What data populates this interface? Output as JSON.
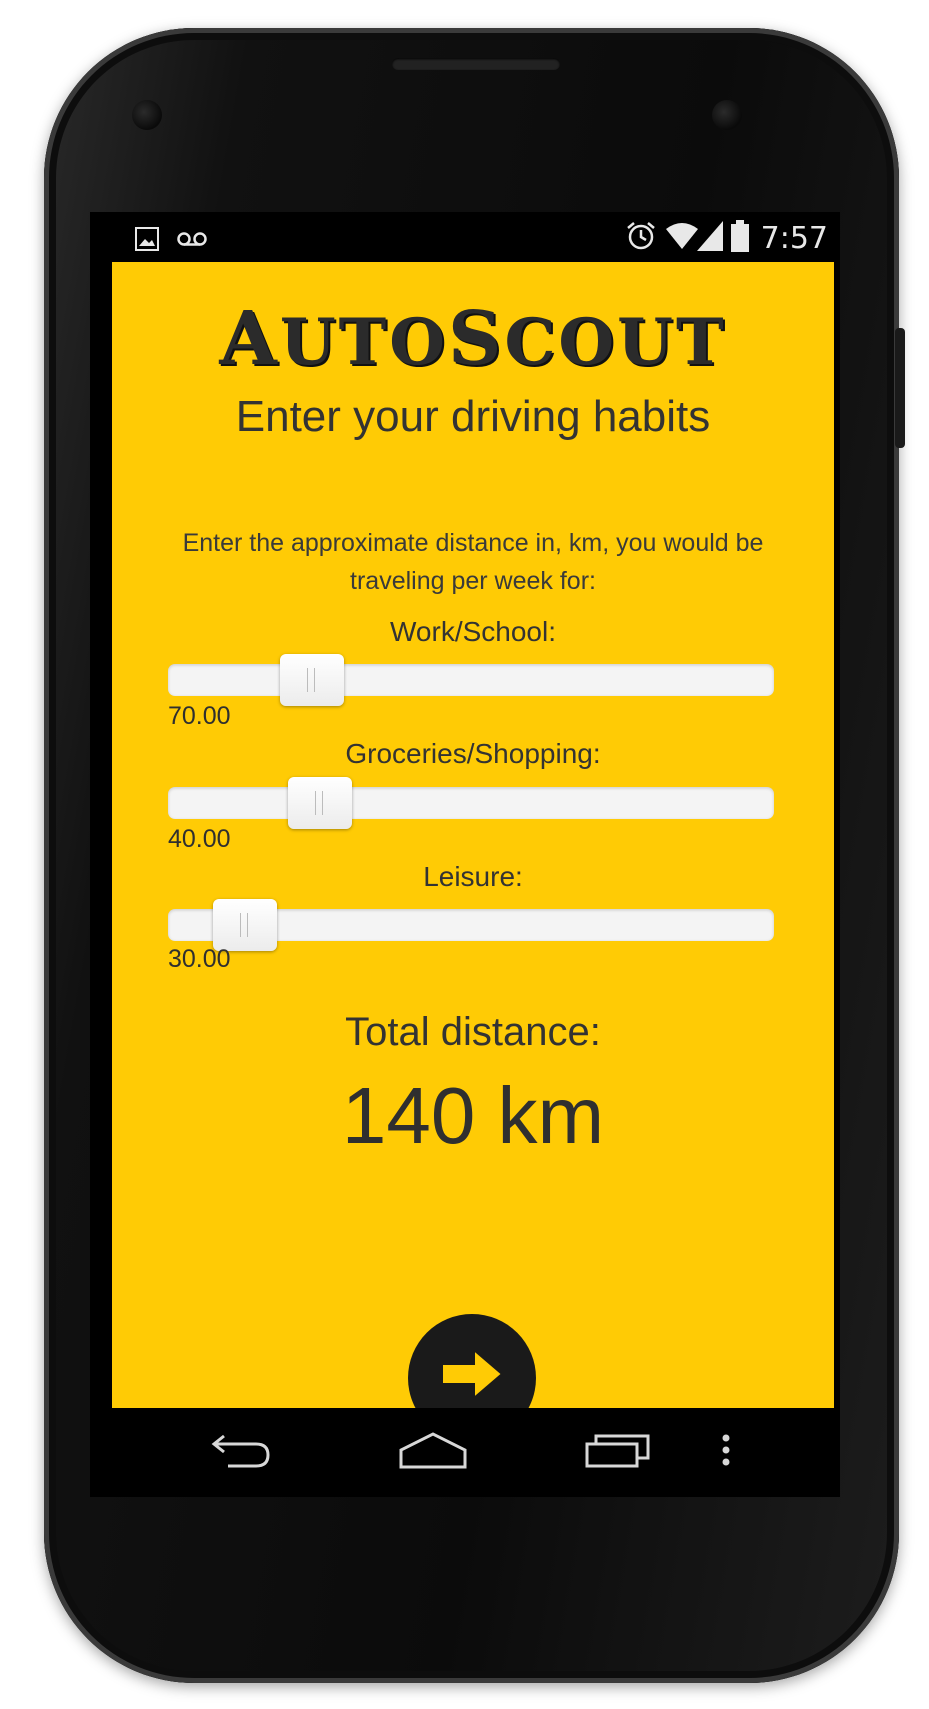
{
  "status_bar": {
    "time": "7:57",
    "left_icons": [
      "image-icon",
      "voicemail-icon"
    ],
    "right_icons": [
      "alarm-icon",
      "wifi-icon",
      "signal-icon",
      "battery-icon"
    ]
  },
  "app": {
    "logo_first": "A",
    "logo_mid": "UTO",
    "logo_second": "S",
    "logo_rest": "COUT",
    "heading": "Enter your driving habits",
    "instructions": "Enter the approximate distance in, km, you would be traveling per week for:",
    "background_color": "#ffcb05",
    "sliders": [
      {
        "label": "Work/School:",
        "value": "70.00",
        "fraction": 0.237
      },
      {
        "label": "Groceries/Shopping:",
        "value": "40.00",
        "fraction": 0.25
      },
      {
        "label": "Leisure:",
        "value": "30.00",
        "fraction": 0.127
      }
    ],
    "total_label": "Total distance:",
    "total_value": "140 km",
    "next_button_icon": "arrow-right-icon"
  },
  "nav_bar": {
    "buttons": [
      "back-icon",
      "home-icon",
      "recent-apps-icon",
      "menu-overflow-icon"
    ]
  }
}
